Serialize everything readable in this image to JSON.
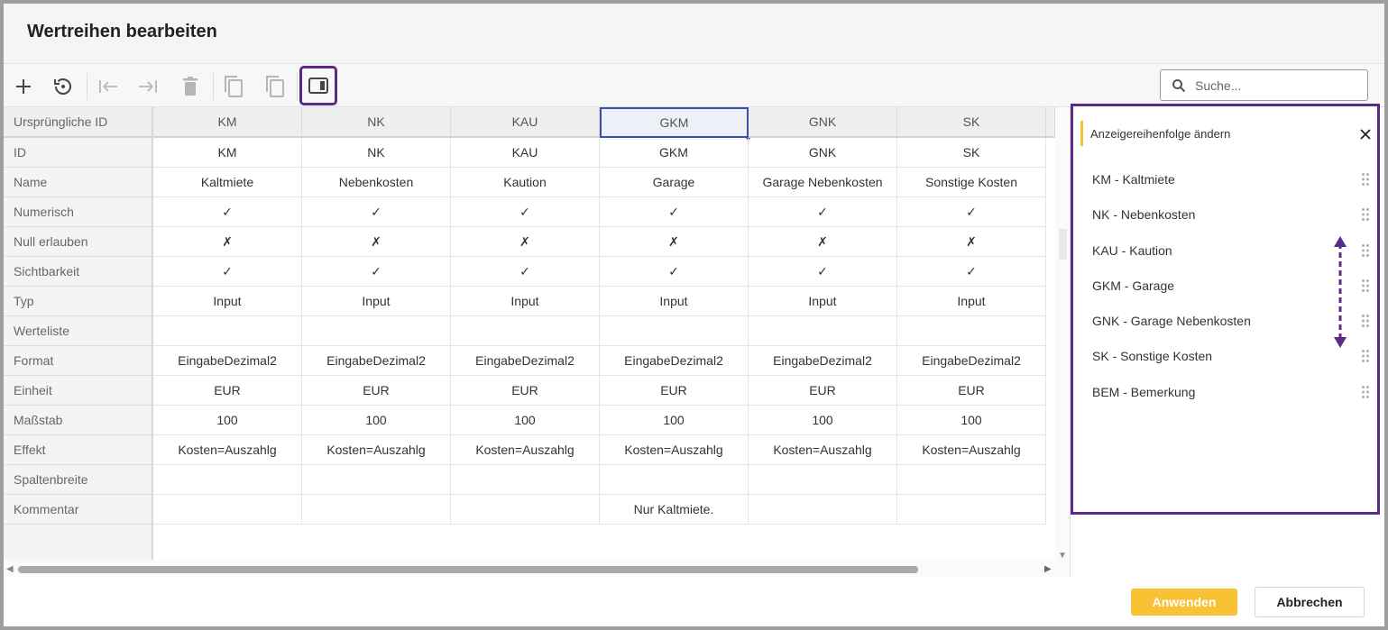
{
  "dialog": {
    "title": "Wertreihen bearbeiten"
  },
  "toolbar": {
    "search_placeholder": "Suche...",
    "icons": [
      "plus-icon",
      "reset-icon",
      "move-left-icon",
      "move-right-icon",
      "delete-icon",
      "copy-icon",
      "paste-icon",
      "panel-icon"
    ]
  },
  "grid": {
    "row_labels": [
      "Ursprüngliche ID",
      "ID",
      "Name",
      "Numerisch",
      "Null erlauben",
      "Sichtbarkeit",
      "Typ",
      "Werteliste",
      "Format",
      "Einheit",
      "Maßstab",
      "Effekt",
      "Spaltenbreite",
      "Kommentar"
    ],
    "columns": [
      {
        "header": "KM",
        "cells": [
          "KM",
          "Kaltmiete",
          "✓",
          "✗",
          "✓",
          "Input",
          "",
          "EingabeDezimal2",
          "EUR",
          "100",
          "Kosten=Auszahlg",
          "",
          ""
        ]
      },
      {
        "header": "NK",
        "cells": [
          "NK",
          "Nebenkosten",
          "✓",
          "✗",
          "✓",
          "Input",
          "",
          "EingabeDezimal2",
          "EUR",
          "100",
          "Kosten=Auszahlg",
          "",
          ""
        ]
      },
      {
        "header": "KAU",
        "cells": [
          "KAU",
          "Kaution",
          "✓",
          "✗",
          "✓",
          "Input",
          "",
          "EingabeDezimal2",
          "EUR",
          "100",
          "Kosten=Auszahlg",
          "",
          ""
        ]
      },
      {
        "header": "GKM",
        "cells": [
          "GKM",
          "Garage",
          "✓",
          "✗",
          "✓",
          "Input",
          "",
          "EingabeDezimal2",
          "EUR",
          "100",
          "Kosten=Auszahlg",
          "",
          "Nur Kaltmiete."
        ]
      },
      {
        "header": "GNK",
        "cells": [
          "GNK",
          "Garage Nebenkosten",
          "✓",
          "✗",
          "✓",
          "Input",
          "",
          "EingabeDezimal2",
          "EUR",
          "100",
          "Kosten=Auszahlg",
          "",
          ""
        ]
      },
      {
        "header": "SK",
        "cells": [
          "SK",
          "Sonstige Kosten",
          "✓",
          "✗",
          "✓",
          "Input",
          "",
          "EingabeDezimal2",
          "EUR",
          "100",
          "Kosten=Auszahlg",
          "",
          ""
        ]
      }
    ],
    "selected_column": "GKM"
  },
  "side_panel": {
    "title": "Anzeigereihenfolge ändern",
    "items": [
      "KM - Kaltmiete",
      "NK - Nebenkosten",
      "KAU - Kaution",
      "GKM - Garage",
      "GNK - Garage Nebenkosten",
      "SK - Sonstige Kosten",
      "BEM - Bemerkung"
    ]
  },
  "footer": {
    "apply_label": "Anwenden",
    "cancel_label": "Abbrechen"
  },
  "colors": {
    "accent": "#5b2a86",
    "apply": "#f9c235",
    "selection": "#3b4ea8"
  }
}
